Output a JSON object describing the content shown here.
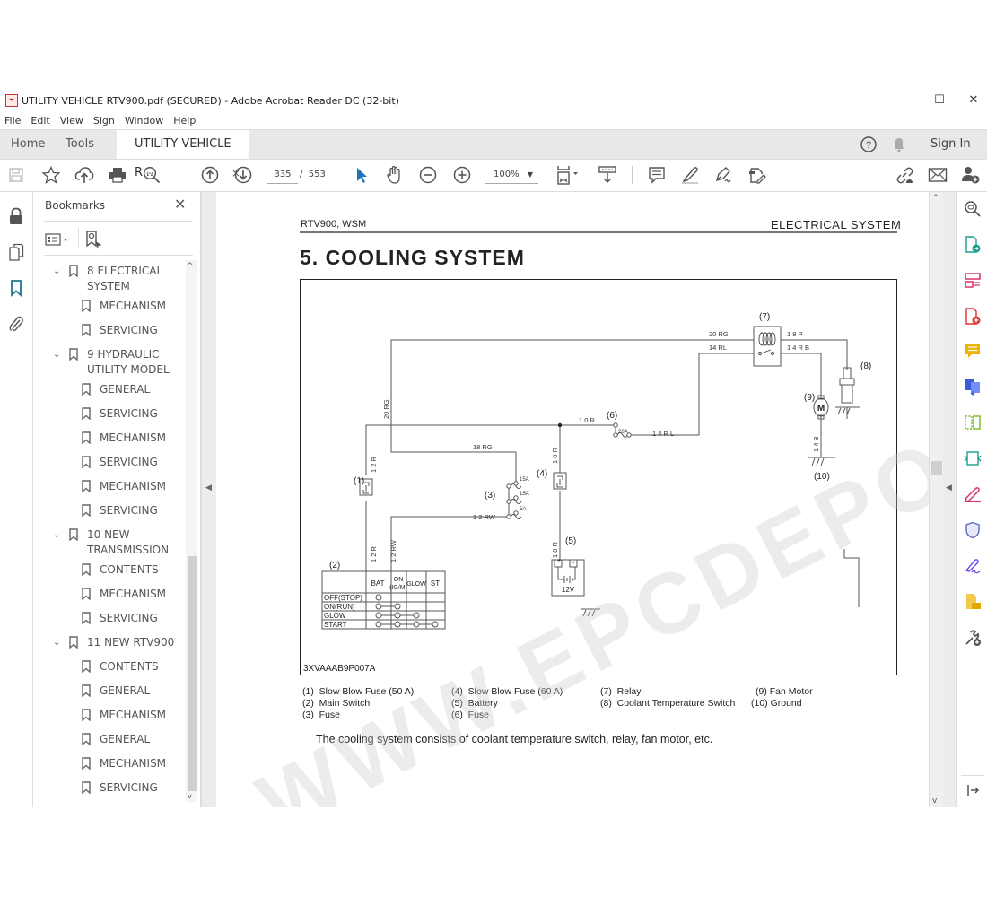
{
  "window": {
    "title": "UTILITY VEHICLE RTV900.pdf (SECURED) - Adobe Acrobat Reader DC (32-bit)",
    "controls": {
      "minimize": "–",
      "maximize": "☐",
      "close": "✕"
    }
  },
  "menu": [
    "File",
    "Edit",
    "View",
    "Sign",
    "Window",
    "Help"
  ],
  "tabs": {
    "home": "Home",
    "tools": "Tools",
    "document": "UTILITY VEHICLE R...",
    "close": "×",
    "sign_in": "Sign In"
  },
  "toolbar": {
    "current_page": "335",
    "page_separator": "/",
    "total_pages": "553",
    "zoom": "100%",
    "icons": [
      "save-icon",
      "bookmark-star-icon",
      "upload-cloud-icon",
      "print-icon",
      "search-zoom-icon",
      "page-up-icon",
      "page-down-icon",
      "select-cursor-icon",
      "hand-icon",
      "zoom-out-icon",
      "zoom-in-icon",
      "fit-page-icon",
      "scroll-mode-icon",
      "comment-icon",
      "highlight-icon",
      "sign-icon",
      "fill-sign-icon",
      "share-link-icon",
      "email-icon",
      "add-user-icon"
    ]
  },
  "bookmarks": {
    "title": "Bookmarks",
    "items": [
      {
        "level": 0,
        "label": "8 ELECTRICAL\nSYSTEM",
        "expanded": true
      },
      {
        "level": 1,
        "label": "MECHANISM"
      },
      {
        "level": 1,
        "label": "SERVICING"
      },
      {
        "level": 0,
        "label": "9 HYDRAULIC\nUTILITY MODEL",
        "expanded": true
      },
      {
        "level": 1,
        "label": "GENERAL"
      },
      {
        "level": 1,
        "label": "SERVICING"
      },
      {
        "level": 1,
        "label": "MECHANISM"
      },
      {
        "level": 1,
        "label": "SERVICING"
      },
      {
        "level": 1,
        "label": "MECHANISM"
      },
      {
        "level": 1,
        "label": "SERVICING"
      },
      {
        "level": 0,
        "label": "10 NEW\nTRANSMISSION",
        "expanded": true
      },
      {
        "level": 1,
        "label": "CONTENTS"
      },
      {
        "level": 1,
        "label": "MECHANISM"
      },
      {
        "level": 1,
        "label": "SERVICING"
      },
      {
        "level": 0,
        "label": "11 NEW RTV900",
        "expanded": true
      },
      {
        "level": 1,
        "label": "CONTENTS"
      },
      {
        "level": 1,
        "label": "GENERAL"
      },
      {
        "level": 1,
        "label": "MECHANISM"
      },
      {
        "level": 1,
        "label": "GENERAL"
      },
      {
        "level": 1,
        "label": "MECHANISM"
      },
      {
        "level": 1,
        "label": "SERVICING"
      }
    ]
  },
  "page": {
    "header_left": "RTV900, WSM",
    "header_right": "ELECTRICAL  SYSTEM",
    "title": "5.  COOLING  SYSTEM",
    "figure_id": "3XVAAAB9P007A",
    "watermark": "WWW.EPCDEPO.COM",
    "diagram": {
      "labels": {
        "c1": "(1)",
        "c2": "(2)",
        "c3": "(3)",
        "c4": "(4)",
        "c5": "(5)",
        "c6": "(6)",
        "c7": "(7)",
        "c8": "(8)",
        "c9": "(9)",
        "c10": "(10)"
      },
      "wires": {
        "w20rg_top": "20 RG",
        "w14rl_top": "14 RL",
        "w18p": "1 8   P",
        "w14rb": "1 4   R B",
        "w20rg_v": "20 RG",
        "w10r_h": "1 0   R",
        "w14rl": "1 4   R L",
        "w18rg": "18 RG",
        "w12r_up": "1 2   R",
        "w10r_v1": "1 0   R",
        "w12rw_h": "1 2    RW",
        "w12r_dn": "1 2   R",
        "w12rw_v": "1 2   RW",
        "w10r_v2": "1 0   R",
        "w14b": "1 4   B"
      },
      "fuse_ratings": {
        "f20": "20A",
        "f15a": "15A",
        "f15b": "15A",
        "f5": "5A"
      },
      "battery_voltage": "12V",
      "motor": "M",
      "switch_table": {
        "columns": [
          "",
          "BAT",
          "ON\n(IG/M)",
          "GLOW",
          "ST"
        ],
        "rows": [
          {
            "label": "OFF(STOP)",
            "on": [
              true,
              false,
              false,
              false
            ]
          },
          {
            "label": "ON(RUN)",
            "on": [
              true,
              true,
              false,
              false
            ]
          },
          {
            "label": "GLOW",
            "on": [
              true,
              true,
              true,
              false
            ]
          },
          {
            "label": "START",
            "on": [
              true,
              true,
              true,
              true
            ]
          }
        ]
      }
    },
    "legend": [
      "(1)  Slow Blow Fuse (50 A)",
      "(2)  Main Switch",
      "(3)  Fuse",
      "(4)  Slow Blow Fuse (60 A)",
      "(5)  Battery",
      "(6)  Fuse",
      "(7)  Relay",
      "(8)  Coolant Temperature Switch",
      "(9) Fan Motor",
      "(10) Ground"
    ],
    "body": "The cooling system consists of coolant temperature switch, relay, fan motor, etc."
  },
  "colors": {
    "accent_blue": "#1e73be",
    "bookmark_active": "#1f7a8c"
  }
}
